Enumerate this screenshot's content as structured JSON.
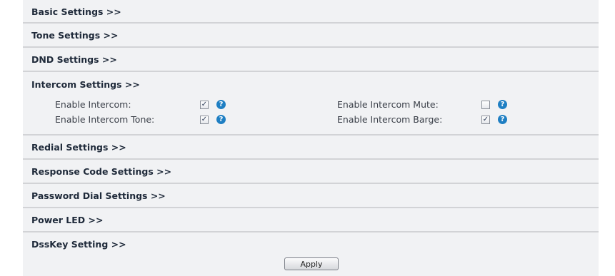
{
  "sections": [
    {
      "label": "Basic Settings >>"
    },
    {
      "label": "Tone Settings >>"
    },
    {
      "label": "DND Settings >>"
    },
    {
      "label": "Intercom Settings >>"
    },
    {
      "label": "Redial Settings >>"
    },
    {
      "label": "Response Code Settings >>"
    },
    {
      "label": "Password Dial Settings >>"
    },
    {
      "label": "Power LED >>"
    },
    {
      "label": "DssKey Setting >>"
    }
  ],
  "intercom": {
    "options": [
      {
        "label": "Enable Intercom:",
        "checked": true
      },
      {
        "label": "Enable Intercom Mute:",
        "checked": false
      },
      {
        "label": "Enable Intercom Tone:",
        "checked": true
      },
      {
        "label": "Enable Intercom Barge:",
        "checked": true
      }
    ]
  },
  "help_glyph": "?",
  "check_glyph": "✓",
  "apply_label": "Apply",
  "colors": {
    "panel_bg": "#f1f2f4",
    "divider": "#d2d3d6",
    "header_text": "#1f2a3a",
    "help_icon": "#1f7fc3"
  }
}
